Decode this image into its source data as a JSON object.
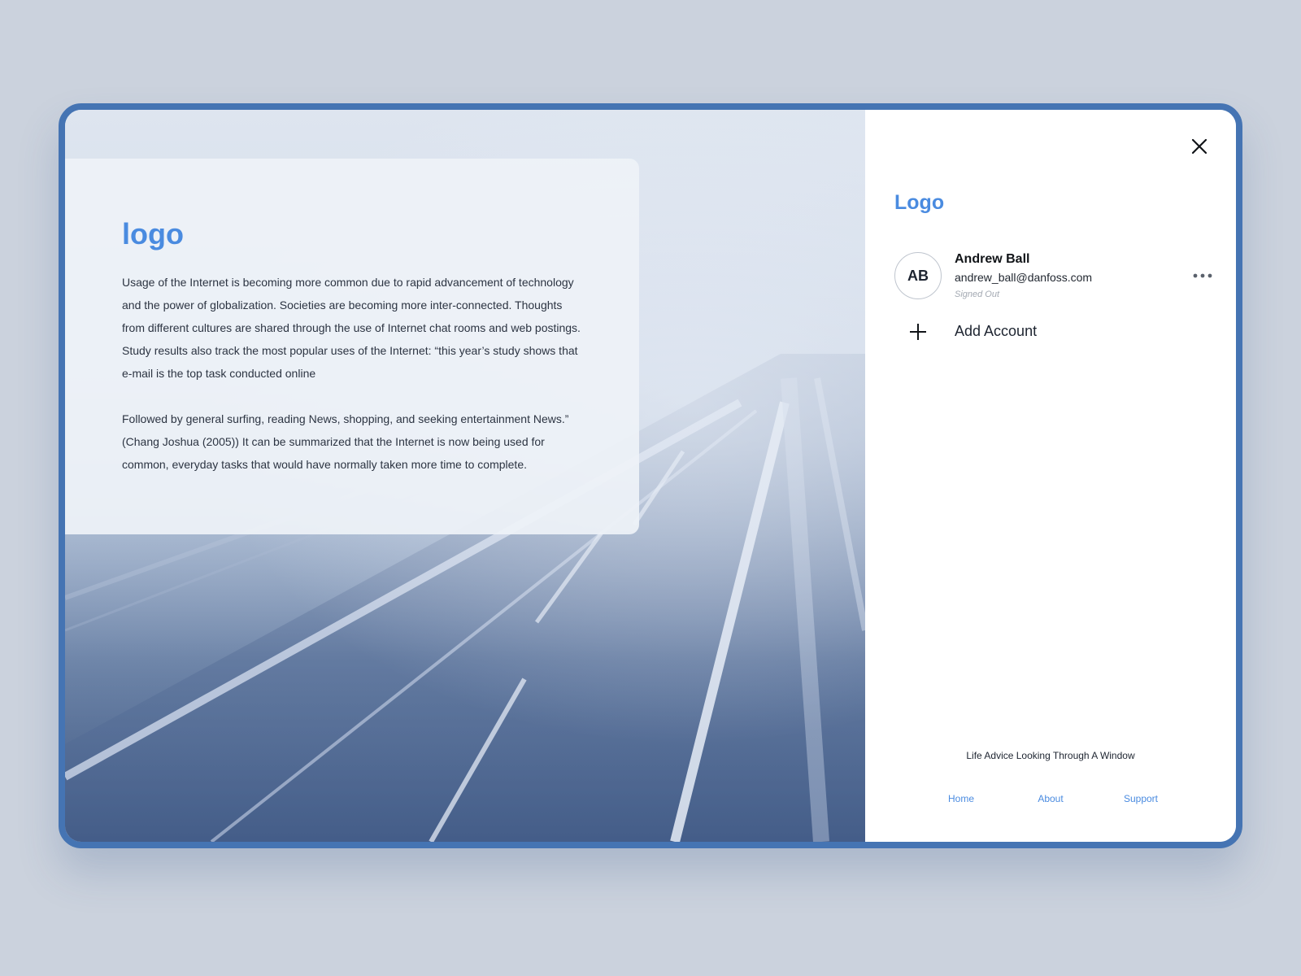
{
  "colors": {
    "accent": "#4a8be0",
    "frame_border": "#4574b3",
    "background": "#cbd2dd"
  },
  "hero": {
    "image": "foggy-highway-photo",
    "card": {
      "logo": "logo",
      "paragraphs": [
        "Usage of the Internet is becoming more common due to rapid advancement of technology and the power of globalization. Societies are becoming more inter-connected. Thoughts from different cultures are shared through the use of Internet chat rooms and web postings. Study results also track the most popular uses of the Internet: “this year’s study shows that e-mail is the top task conducted online",
        "Followed by general surfing, reading News, shopping, and seeking entertainment News.” (Chang Joshua (2005)) It can be summarized that the Internet is now being used for common, everyday tasks that would have normally taken more time to complete."
      ]
    }
  },
  "panel": {
    "close_icon": "close-icon",
    "logo": "Logo",
    "account": {
      "initials": "AB",
      "name": "Andrew Ball",
      "email": "andrew_ball@danfoss.com",
      "status": "Signed Out",
      "more_icon": "more-horizontal-icon"
    },
    "add_account": {
      "icon": "plus-icon",
      "label": "Add Account"
    },
    "tagline": "Life Advice Looking Through A Window",
    "footer_links": [
      "Home",
      "About",
      "Support"
    ]
  }
}
